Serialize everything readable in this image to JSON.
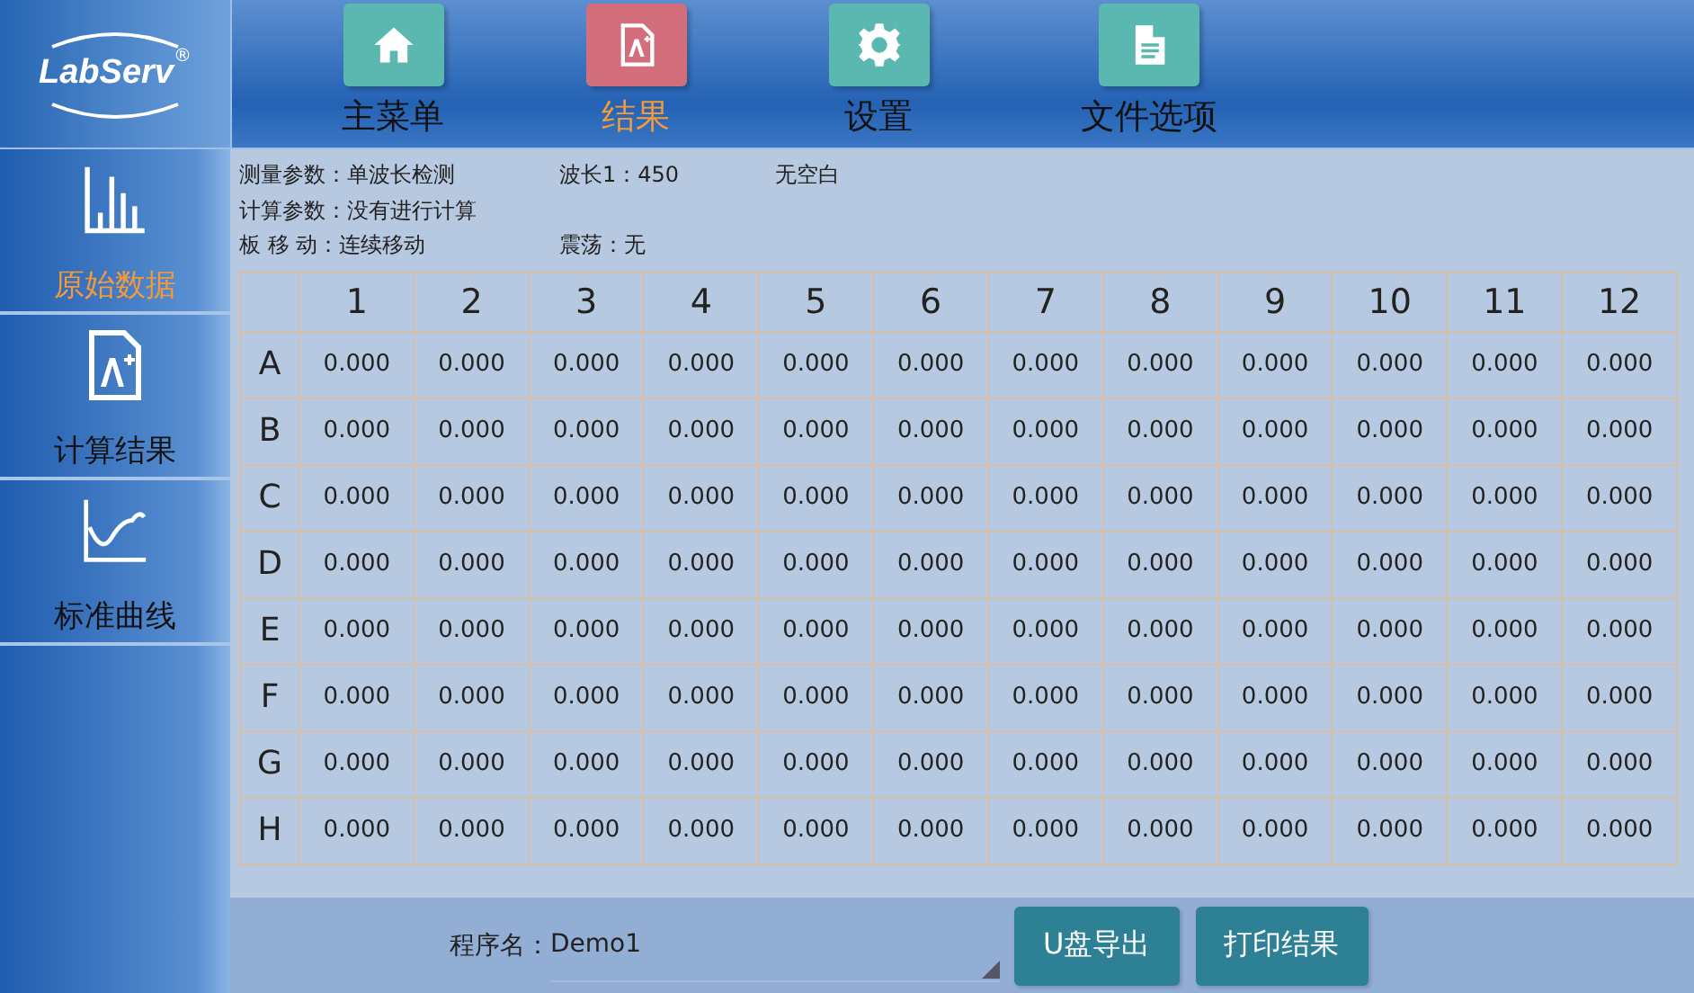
{
  "logo": "LabServ",
  "logo_mark": "®",
  "tabs": [
    {
      "label": "主菜单",
      "selected": false
    },
    {
      "label": "结果",
      "selected": true
    },
    {
      "label": "设置",
      "selected": false
    },
    {
      "label": "文件选项",
      "selected": false
    }
  ],
  "sidebar": {
    "items": [
      {
        "label": "原始数据",
        "selected": true
      },
      {
        "label": "计算结果",
        "selected": false
      },
      {
        "label": "标准曲线",
        "selected": false
      }
    ]
  },
  "info": [
    [
      "测量参数：单波长检测",
      "波长1：450",
      "无空白"
    ],
    [
      "计算参数：没有进行计算"
    ],
    [
      "板 移 动：连续移动",
      "震荡：无"
    ]
  ],
  "table": {
    "columns": [
      "1",
      "2",
      "3",
      "4",
      "5",
      "6",
      "7",
      "8",
      "9",
      "10",
      "11",
      "12"
    ],
    "rows": [
      {
        "label": "A",
        "cells": [
          "0.000",
          "0.000",
          "0.000",
          "0.000",
          "0.000",
          "0.000",
          "0.000",
          "0.000",
          "0.000",
          "0.000",
          "0.000",
          "0.000"
        ]
      },
      {
        "label": "B",
        "cells": [
          "0.000",
          "0.000",
          "0.000",
          "0.000",
          "0.000",
          "0.000",
          "0.000",
          "0.000",
          "0.000",
          "0.000",
          "0.000",
          "0.000"
        ]
      },
      {
        "label": "C",
        "cells": [
          "0.000",
          "0.000",
          "0.000",
          "0.000",
          "0.000",
          "0.000",
          "0.000",
          "0.000",
          "0.000",
          "0.000",
          "0.000",
          "0.000"
        ]
      },
      {
        "label": "D",
        "cells": [
          "0.000",
          "0.000",
          "0.000",
          "0.000",
          "0.000",
          "0.000",
          "0.000",
          "0.000",
          "0.000",
          "0.000",
          "0.000",
          "0.000"
        ]
      },
      {
        "label": "E",
        "cells": [
          "0.000",
          "0.000",
          "0.000",
          "0.000",
          "0.000",
          "0.000",
          "0.000",
          "0.000",
          "0.000",
          "0.000",
          "0.000",
          "0.000"
        ]
      },
      {
        "label": "F",
        "cells": [
          "0.000",
          "0.000",
          "0.000",
          "0.000",
          "0.000",
          "0.000",
          "0.000",
          "0.000",
          "0.000",
          "0.000",
          "0.000",
          "0.000"
        ]
      },
      {
        "label": "G",
        "cells": [
          "0.000",
          "0.000",
          "0.000",
          "0.000",
          "0.000",
          "0.000",
          "0.000",
          "0.000",
          "0.000",
          "0.000",
          "0.000",
          "0.000"
        ]
      },
      {
        "label": "H",
        "cells": [
          "0.000",
          "0.000",
          "0.000",
          "0.000",
          "0.000",
          "0.000",
          "0.000",
          "0.000",
          "0.000",
          "0.000",
          "0.000",
          "0.000"
        ]
      }
    ]
  },
  "footer": {
    "program_label": "程序名：",
    "program_value": "Demo1",
    "buttons": [
      "U盘导出",
      "打印结果"
    ]
  }
}
